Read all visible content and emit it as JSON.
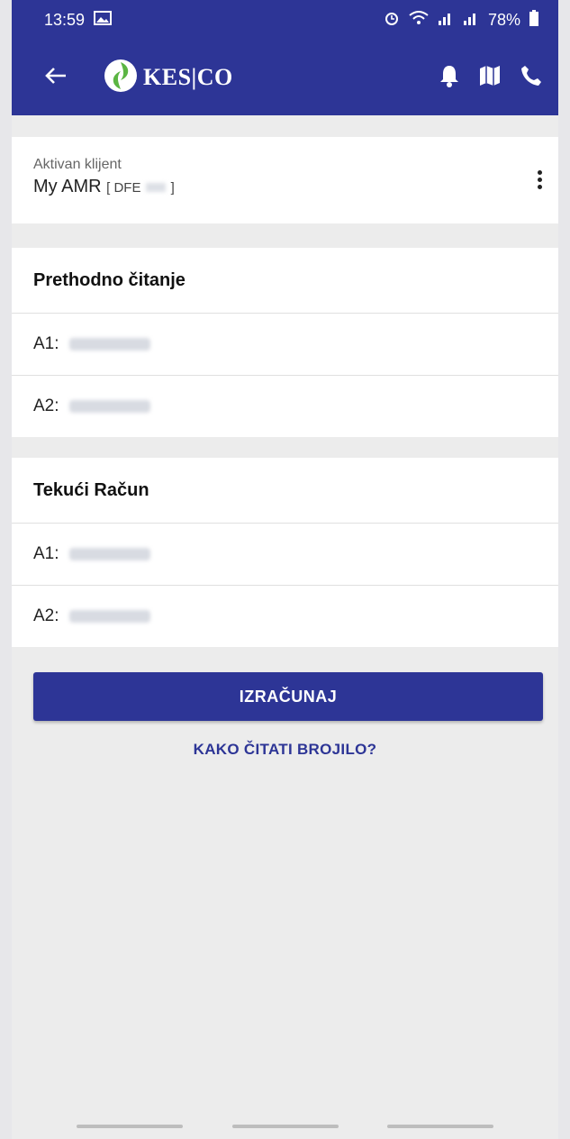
{
  "status_bar": {
    "time": "13:59",
    "battery": "78%",
    "icons": [
      "image-icon",
      "alarm-icon",
      "wifi-icon",
      "signal-icon",
      "signal-icon",
      "battery-icon"
    ]
  },
  "app_bar": {
    "brand": "KES|CO",
    "icons": [
      "back-arrow-icon",
      "bell-icon",
      "map-icon",
      "phone-icon"
    ]
  },
  "client": {
    "label": "Aktivan klijent",
    "name": "My AMR",
    "code": "[ DFE",
    "code_end": "]"
  },
  "previous_reading": {
    "title": "Prethodno čitanje",
    "rows": [
      {
        "label": "A1:"
      },
      {
        "label": "A2:"
      }
    ]
  },
  "current_bill": {
    "title": "Tekući Račun",
    "rows": [
      {
        "label": "A1:"
      },
      {
        "label": "A2:"
      }
    ]
  },
  "actions": {
    "calculate": "IZRAČUNAJ",
    "how_to_read": "KAKO ČITATI BROJILO?"
  },
  "colors": {
    "primary": "#2d3596",
    "background": "#ececec",
    "logo_green": "#5bb543"
  }
}
